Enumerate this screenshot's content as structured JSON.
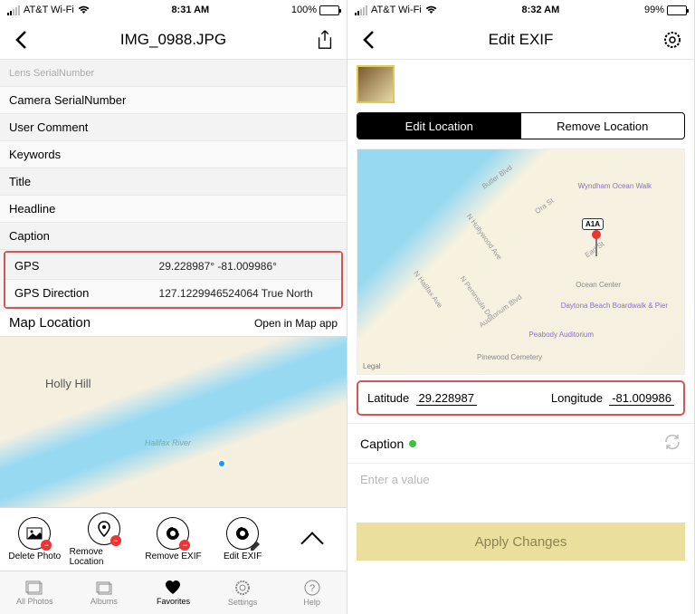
{
  "left": {
    "status": {
      "carrier": "AT&T Wi-Fi",
      "time": "8:31 AM",
      "battery_pct": "100%"
    },
    "nav": {
      "title": "IMG_0988.JPG"
    },
    "rows": {
      "lens_serial": "Lens SerialNumber",
      "camera_serial": "Camera SerialNumber",
      "user_comment": "User Comment",
      "keywords": "Keywords",
      "title": "Title",
      "headline": "Headline",
      "caption": "Caption",
      "gps_label": "GPS",
      "gps_value": "29.228987° -81.009986°",
      "gps_dir_label": "GPS Direction",
      "gps_dir_value": "127.1229946524064 True North"
    },
    "map_section": {
      "header": "Map Location",
      "open_link": "Open in Map app",
      "place1": "Holly Hill",
      "place2": "Halifax River"
    },
    "toolbar": {
      "delete": "Delete Photo",
      "remove_loc": "Remove Location",
      "remove_exif": "Remove EXIF",
      "edit_exif": "Edit EXIF"
    },
    "tabs": {
      "all": "All Photos",
      "albums": "Albums",
      "favorites": "Favorites",
      "settings": "Settings",
      "help": "Help"
    }
  },
  "right": {
    "status": {
      "carrier": "AT&T Wi-Fi",
      "time": "8:32 AM",
      "battery_pct": "99%"
    },
    "nav": {
      "title": "Edit EXIF"
    },
    "seg": {
      "edit": "Edit Location",
      "remove": "Remove Location"
    },
    "map_pois": {
      "a": "Wyndham Ocean Walk",
      "b": "Ocean Center",
      "c": "Daytona Beach Boardwalk & Pier",
      "d": "Peabody Auditorium",
      "e": "Pinewood Cemetery",
      "legal": "Legal",
      "route": "A1A"
    },
    "streets": {
      "butler": "Butler Blvd",
      "ora": "Ora St",
      "earl": "Earl St",
      "hollywood": "N Hollywood Ave",
      "auditorium": "Auditorium Blvd",
      "halifax": "N Halifax Ave",
      "peninsula": "N Peninsula Dr"
    },
    "coords": {
      "lat_label": "Latitude",
      "lat_val": "29.228987",
      "lon_label": "Longitude",
      "lon_val": "-81.009986"
    },
    "caption": {
      "label": "Caption",
      "placeholder": "Enter a value"
    },
    "apply": "Apply Changes"
  }
}
